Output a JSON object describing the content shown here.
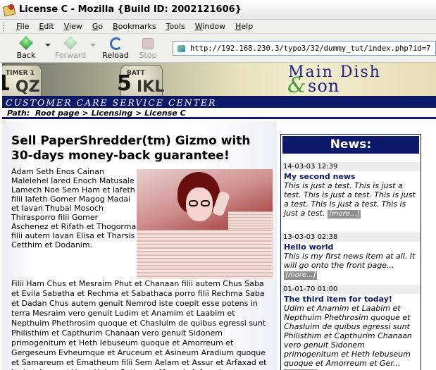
{
  "window": {
    "title": "License C - Mozilla {Build ID: 2002121606}"
  },
  "menubar": {
    "items": [
      {
        "label": "File",
        "accel": "F",
        "rest": "ile"
      },
      {
        "label": "Edit",
        "accel": "E",
        "rest": "dit"
      },
      {
        "label": "View",
        "accel": "V",
        "rest": "iew"
      },
      {
        "label": "Go",
        "accel": "G",
        "rest": "o"
      },
      {
        "label": "Bookmarks",
        "accel": "B",
        "rest": "ookmarks"
      },
      {
        "label": "Tools",
        "accel": "T",
        "rest": "ools"
      },
      {
        "label": "Window",
        "accel": "W",
        "rest": "indow"
      },
      {
        "label": "Help",
        "accel": "H",
        "rest": "elp"
      }
    ]
  },
  "navbar": {
    "back_label": "Back",
    "forward_label": "Forward",
    "reload_label": "Reload",
    "stop_label": "Stop",
    "url": "http://192.168.230.3/typo3/32/dummy_tut/index.php?id=7"
  },
  "banner": {
    "key1_small": "TIMER 1",
    "key1_big": "QZ",
    "key1_num": "1",
    "key2_small": "BATT",
    "key2_big": "IKL",
    "key2_num": "5",
    "brand_line1": "Main Dish",
    "brand_amp": "&",
    "brand_line2": "son",
    "service": "CUSTOMER CARE SERVICE CENTER"
  },
  "path": {
    "prefix": "Path:",
    "crumbs": [
      "Root page",
      "Licensing",
      "License C"
    ],
    "separator": ">"
  },
  "main": {
    "headline": "Sell PaperShredder(tm) Gizmo with 30-days money-back guarantee!",
    "paragraph1": "Adam Seth Enos Cainan Malelehel Iared Enoch Matusale Lamech Noe Sem Ham et Iafeth filii Iafeth Gomer Magog Madai et Iavan Thubal Mosoch Thirasporro filii Gomer Aschenez et Rifath et Thogorma filii autem Iavan Elisa et Tharsis Cetthim et Dodanim.",
    "paragraph2": "Filii Ham Chus et Mesraim Phut et Chanaan filii autem Chus Saba et Evila Sabatha et Rechma et Sabathaca porro filii Rechma Saba et Dadan Chus autem genuit Nemrod iste coepit esse potens in terra Mesraim vero genuit Ludim et Anamim et Laabim et Nepthuim Phethrosim quoque et Chasluim de quibus egressi sunt Philisthim et Capthurim Chanaan vero genuit Sidonem primogenitum et Heth Iebuseum quoque et Amorreum et Gergeseum Evheumque et Aruceum et Asineum Aradium quoque et Samareum et Ematheum filii Sem Aelam et Assur et Arfaxad et Lud et Aram et Us et Hul et Gother et Mosoch Arfaxad autem genuit Sala qui et ipse genuit Heber"
  },
  "news": {
    "heading": "News:",
    "more_label": "[more...]",
    "items": [
      {
        "date": "14-03-03 12:39",
        "title": "My second news",
        "text": "This is just a test. This is just a test. This is just a test. This is just a test. This is just a test. This is just a test."
      },
      {
        "date": "13-03-03 02:38",
        "title": "Hello world",
        "text": "This is my first news item at all. It will go onto the front page..."
      },
      {
        "date": "01-01-70 01:00",
        "title": "The third item for today!",
        "text": "Udim et Anamim et Laabim et Nepthuim Phethrosim quoque et Chasluim de quibus egressi sunt Philisthim et Capthurim Chanaan vero genuit Sidonem primogenitum et Heth Iebuseum quoque et Amorreum et Ger..."
      }
    ]
  }
}
